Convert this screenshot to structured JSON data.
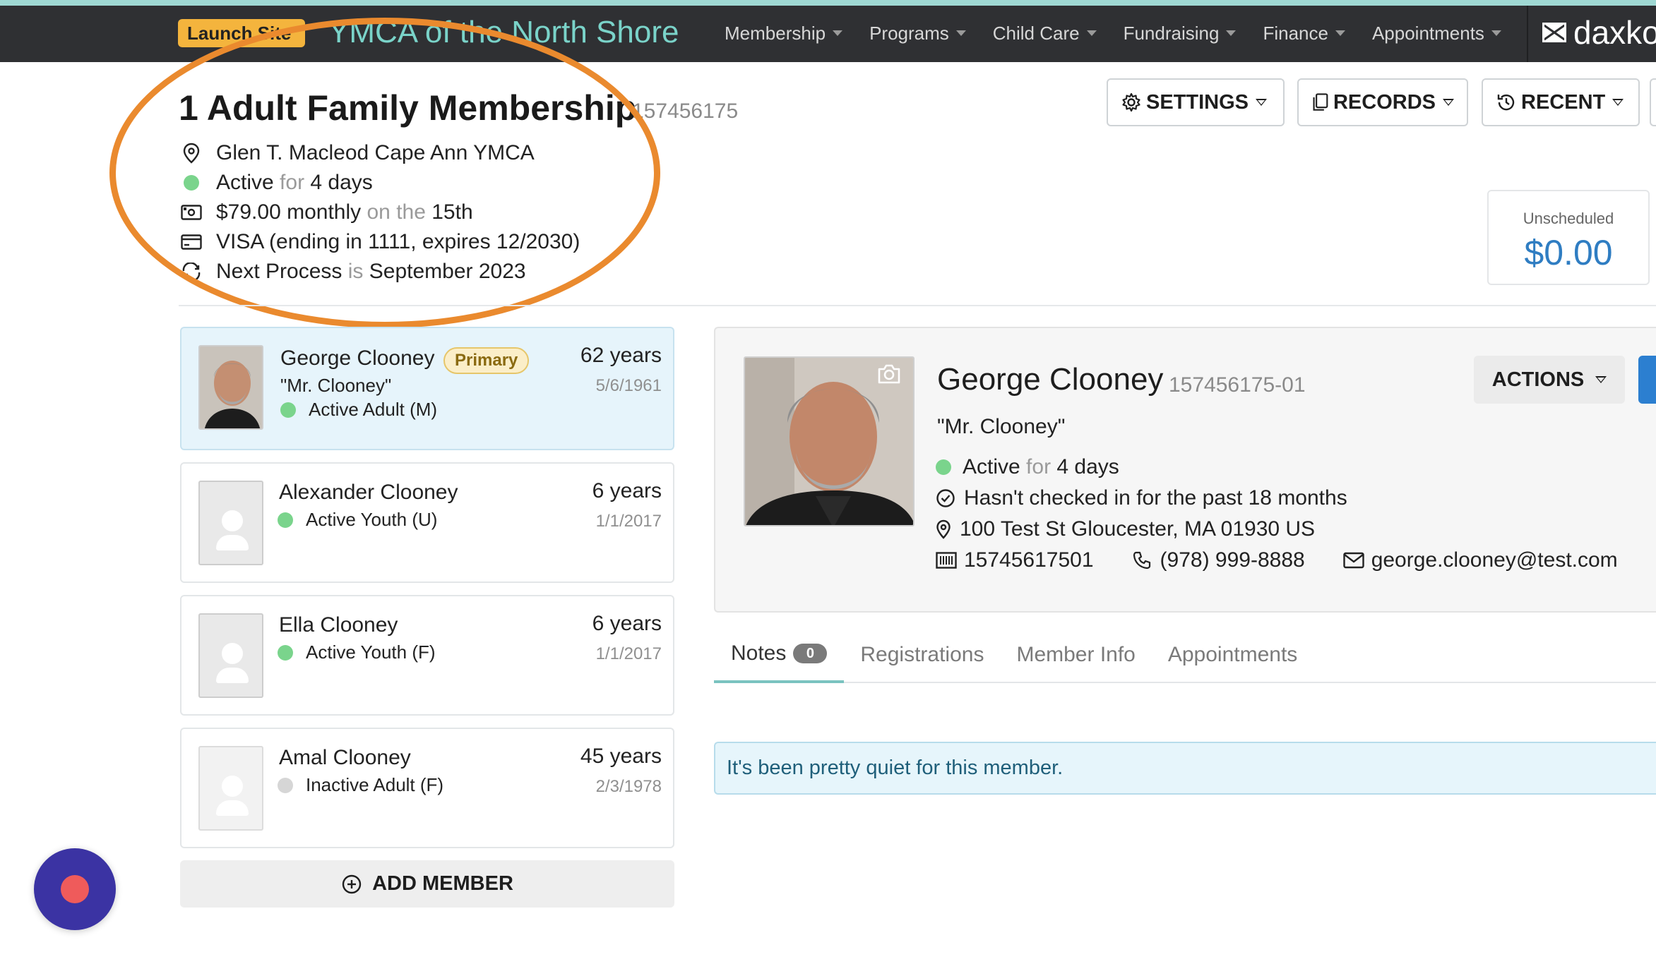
{
  "nav": {
    "launch_label": "Launch Site",
    "org_name": "YMCA of the North Shore",
    "menu": [
      "Membership",
      "Programs",
      "Child Care",
      "Fundraising",
      "Finance",
      "Appointments"
    ],
    "brand": "daxko"
  },
  "membership": {
    "title": "1 Adult Family Membership",
    "id": "157456175",
    "branch": "Glen T. Macleod Cape Ann YMCA",
    "status": "Active",
    "status_for": "for",
    "status_duration": "4 days",
    "amount": "$79.00 monthly",
    "on_the": "on the",
    "billing_day": "15th",
    "payment": "VISA (ending in 1111, expires 12/2030)",
    "next_process_label": "Next Process",
    "next_is": "is",
    "next_process_value": "September 2023"
  },
  "header_buttons": {
    "settings": "SETTINGS",
    "records": "RECORDS",
    "recent": "RECENT"
  },
  "unscheduled": {
    "label": "Unscheduled",
    "amount": "$0.00"
  },
  "members": [
    {
      "name": "George Clooney",
      "badge": "Primary",
      "nickname": "\"Mr. Clooney\"",
      "status": "Active Adult (M)",
      "age": "62 years",
      "dob": "5/6/1961",
      "active": true
    },
    {
      "name": "Alexander Clooney",
      "status": "Active Youth (U)",
      "age": "6 years",
      "dob": "1/1/2017",
      "active": true
    },
    {
      "name": "Ella Clooney",
      "status": "Active Youth (F)",
      "age": "6 years",
      "dob": "1/1/2017",
      "active": true
    },
    {
      "name": "Amal Clooney",
      "status": "Inactive Adult (F)",
      "age": "45 years",
      "dob": "2/3/1978",
      "active": false
    }
  ],
  "add_member_label": "ADD MEMBER",
  "detail": {
    "name": "George Clooney",
    "id": "157456175-01",
    "nickname": "\"Mr. Clooney\"",
    "status": "Active",
    "status_for": "for",
    "status_duration": "4 days",
    "checkin": "Hasn't checked in for the past 18 months",
    "address": "100 Test St Gloucester, MA 01930 US",
    "barcode": "15745617501",
    "phone": "(978) 999-8888",
    "email": "george.clooney@test.com",
    "actions_label": "ACTIONS"
  },
  "tabs": [
    {
      "label": "Notes",
      "count": "0"
    },
    {
      "label": "Registrations"
    },
    {
      "label": "Member Info"
    },
    {
      "label": "Appointments"
    }
  ],
  "notes_message": "It's been pretty quiet for this member.",
  "colors": {
    "nav_bg": "#2f3033",
    "accent_teal": "#7ad3c9",
    "highlight_orange": "#ea8a2e",
    "active_green": "#7ad48c",
    "link_blue": "#2f7dc2",
    "chat_purple": "#3b33a3"
  }
}
